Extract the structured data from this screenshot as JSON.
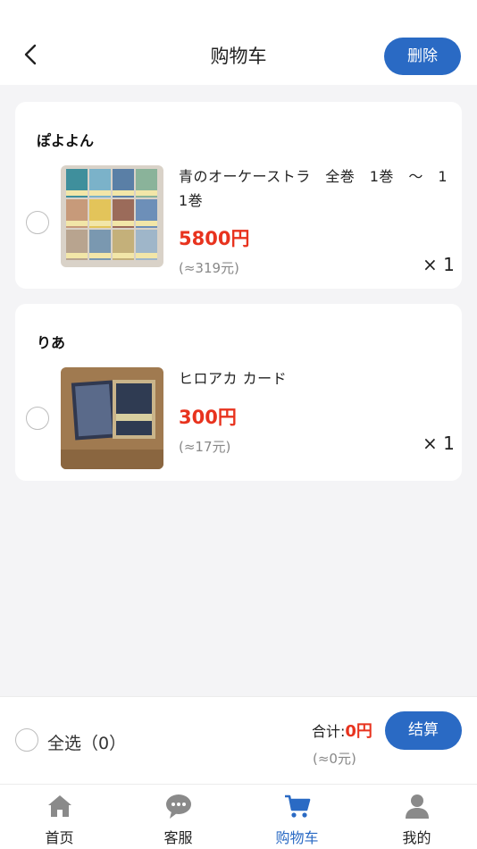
{
  "header": {
    "title": "购物车",
    "delete_label": "删除"
  },
  "stores": [
    {
      "seller": "ぽよよん",
      "item": {
        "name_line1": "青のオーケーストラ　全巻　1巻　～　1",
        "name_line2": "1巻",
        "price": "5800円",
        "approx": "(≈319元)",
        "qty": "× 1"
      }
    },
    {
      "seller": "りあ",
      "item": {
        "name_line1": "ヒロアカ カード",
        "name_line2": "",
        "price": "300円",
        "approx": "(≈17元)",
        "qty": "× 1"
      }
    }
  ],
  "footer": {
    "select_all": "全选（0）",
    "total_label": "合计:",
    "total_value": "0円",
    "total_approx": "(≈0元)",
    "checkout_label": "结算"
  },
  "tabs": [
    {
      "label": "首页",
      "icon": "home-icon"
    },
    {
      "label": "客服",
      "icon": "chat-icon"
    },
    {
      "label": "购物车",
      "icon": "cart-icon",
      "active": true
    },
    {
      "label": "我的",
      "icon": "user-icon"
    }
  ],
  "colors": {
    "accent": "#2a6ac4",
    "price": "#e8331e",
    "background": "#f4f4f6"
  }
}
